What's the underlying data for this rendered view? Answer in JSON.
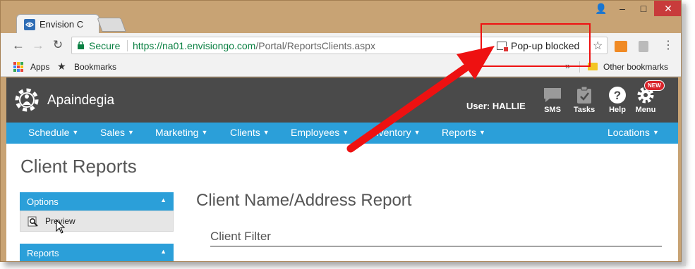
{
  "browser": {
    "tab_title": "Envision C",
    "window_controls": {
      "user": "👤",
      "minimize": "–",
      "maximize": "□",
      "close": "✕"
    },
    "nav": {
      "back": "←",
      "forward": "→",
      "reload": "↻"
    },
    "secure_label": "Secure",
    "url_host": "https://na01.envisiongo.com",
    "url_path": "/Portal/ReportsClients.aspx",
    "popup_blocked_label": "Pop-up blocked",
    "star": "☆",
    "kebab": "⋮",
    "icons": [
      "lock-icon",
      "popup-blocked-icon",
      "star-icon",
      "extension-icon",
      "pdf-extension-icon",
      "kebab-menu-icon"
    ]
  },
  "bookmarks": {
    "apps_label": "Apps",
    "bookmarks_label": "Bookmarks",
    "more": "»",
    "other_bookmarks": "Other bookmarks"
  },
  "app": {
    "name": "Apaindegia",
    "user_label": "User: HALLIE",
    "header_icons": [
      {
        "label": "SMS",
        "icon": "chat-icon"
      },
      {
        "label": "Tasks",
        "icon": "clipboard-icon"
      },
      {
        "label": "Help",
        "icon": "help-icon"
      },
      {
        "label": "Menu",
        "icon": "gear-icon"
      }
    ],
    "new_badge": "NEW",
    "nav": [
      {
        "label": "Schedule"
      },
      {
        "label": "Sales"
      },
      {
        "label": "Marketing"
      },
      {
        "label": "Clients"
      },
      {
        "label": "Employees"
      },
      {
        "label": "Inventory"
      },
      {
        "label": "Reports"
      },
      {
        "label": "Locations"
      }
    ],
    "caret": "▼"
  },
  "page": {
    "title": "Client Reports",
    "options_label": "Options",
    "preview_label": "Preview",
    "reports_label": "Reports",
    "collapse": "▲",
    "report_title": "Client Name/Address Report",
    "filter_label": "Client Filter"
  },
  "colors": {
    "frame": "#c8a374",
    "header": "#4a4a4a",
    "nav": "#2b9fd9",
    "annotation": "#ee1111",
    "secure": "#0b8043"
  }
}
